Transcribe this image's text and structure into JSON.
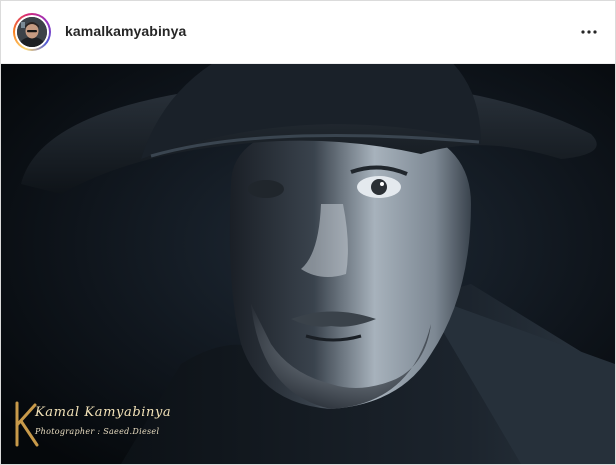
{
  "post": {
    "username": "kamalkamyabinya",
    "more_icon": "more-horizontal-icon",
    "avatar_icon": "profile-avatar"
  },
  "photo": {
    "subject": "black-and-white portrait of a bearded man in a wide-brimmed hat",
    "watermark": {
      "monogram": "K",
      "name": "Kamal Kamyabinya",
      "credit": "Photographer : Saeed.Diesel"
    }
  },
  "colors": {
    "username": "#262626",
    "border": "#dbdbdb",
    "watermark": "#c89a4a"
  }
}
